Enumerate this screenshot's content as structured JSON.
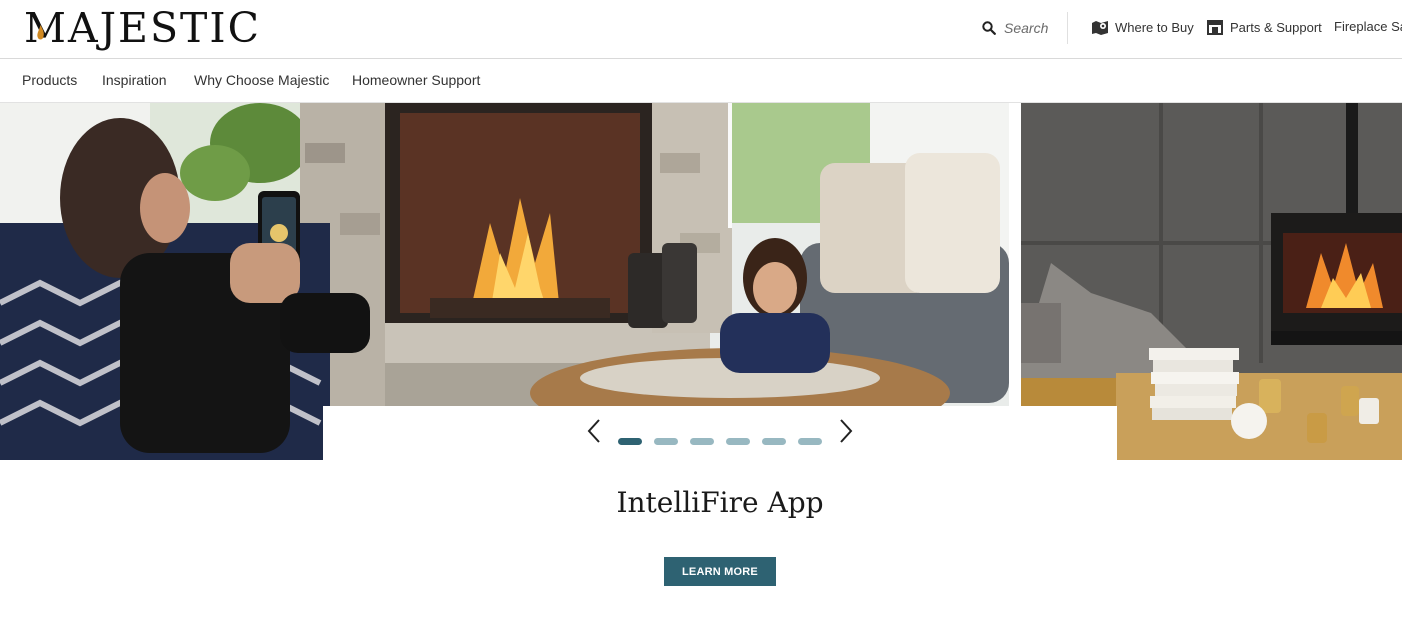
{
  "header": {
    "logo": "MAJESTIC",
    "search": {
      "placeholder": "Search"
    },
    "utility_links": [
      {
        "label": "Where to Buy",
        "icon": "map-pin-icon"
      },
      {
        "label": "Parts & Support",
        "icon": "storefront-icon"
      },
      {
        "label": "Fireplace Sa",
        "icon": ""
      }
    ]
  },
  "nav": {
    "items": [
      {
        "label": "Products"
      },
      {
        "label": "Inspiration"
      },
      {
        "label": "Why Choose Majestic"
      },
      {
        "label": "Homeowner Support"
      }
    ]
  },
  "carousel": {
    "slide_count": 6,
    "active_index": 0,
    "title": "IntelliFire App",
    "button_label": "LEARN MORE",
    "prev_icon": "chevron-left-icon",
    "next_icon": "chevron-right-icon"
  },
  "colors": {
    "accent": "#2e6272",
    "dot_active": "#2e6272",
    "dot_inactive": "#98b8c1"
  }
}
